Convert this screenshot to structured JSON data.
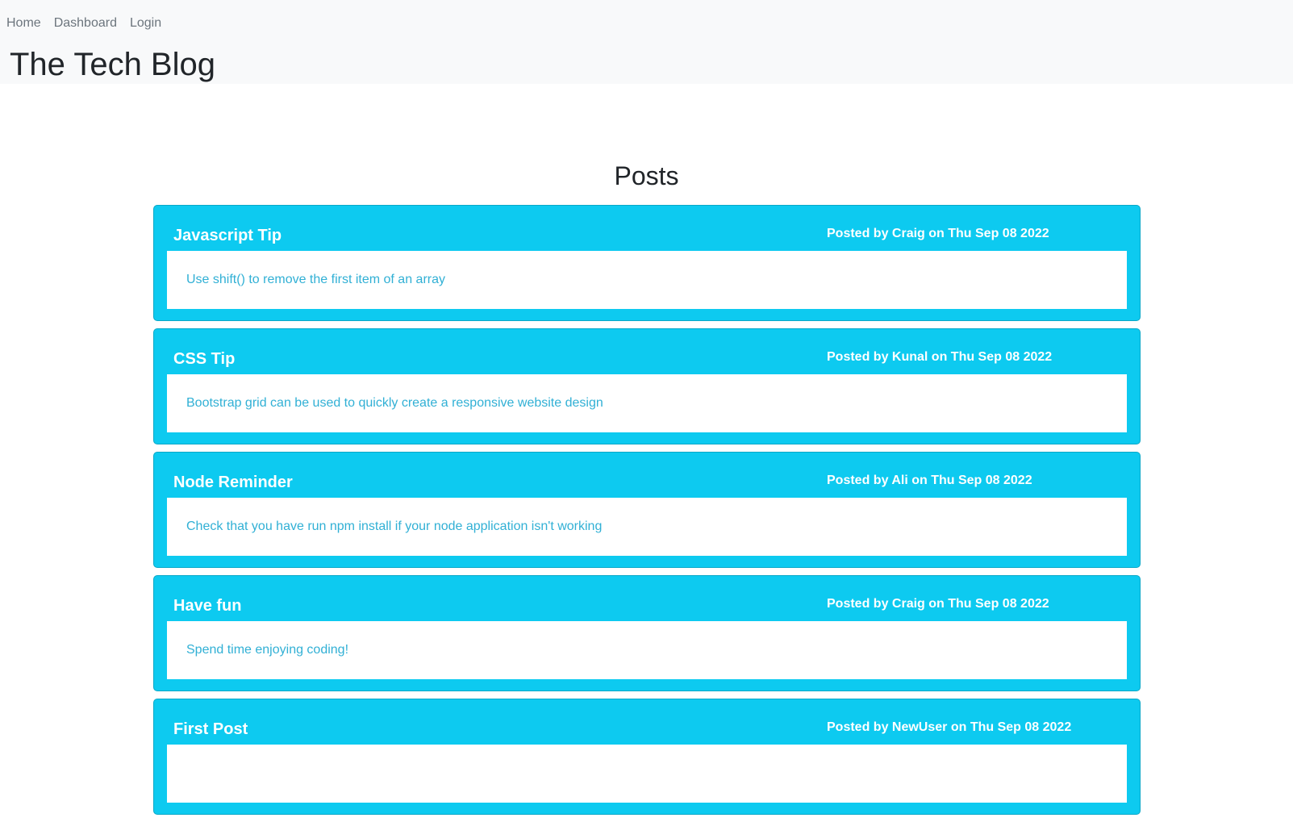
{
  "nav": {
    "items": [
      {
        "label": "Home"
      },
      {
        "label": "Dashboard"
      },
      {
        "label": "Login"
      }
    ]
  },
  "site": {
    "title": "The Tech Blog"
  },
  "main": {
    "heading": "Posts",
    "posts": [
      {
        "title": "Javascript Tip",
        "meta": "Posted by Craig on Thu Sep 08 2022",
        "content": "Use shift() to remove the first item of an array"
      },
      {
        "title": "CSS Tip",
        "meta": "Posted by Kunal on Thu Sep 08 2022",
        "content": "Bootstrap grid can be used to quickly create a responsive website design"
      },
      {
        "title": "Node Reminder",
        "meta": "Posted by Ali on Thu Sep 08 2022",
        "content": "Check that you have run npm install if your node application isn't working"
      },
      {
        "title": "Have fun",
        "meta": "Posted by Craig on Thu Sep 08 2022",
        "content": "Spend time enjoying coding!"
      },
      {
        "title": "First Post",
        "meta": "Posted by NewUser on Thu Sep 08 2022",
        "content": ""
      }
    ]
  },
  "colors": {
    "header_bg": "#f8f9fa",
    "card_bg": "#0dcaf0",
    "body_text": "#31b0d5",
    "nav_text": "#6c757d"
  }
}
